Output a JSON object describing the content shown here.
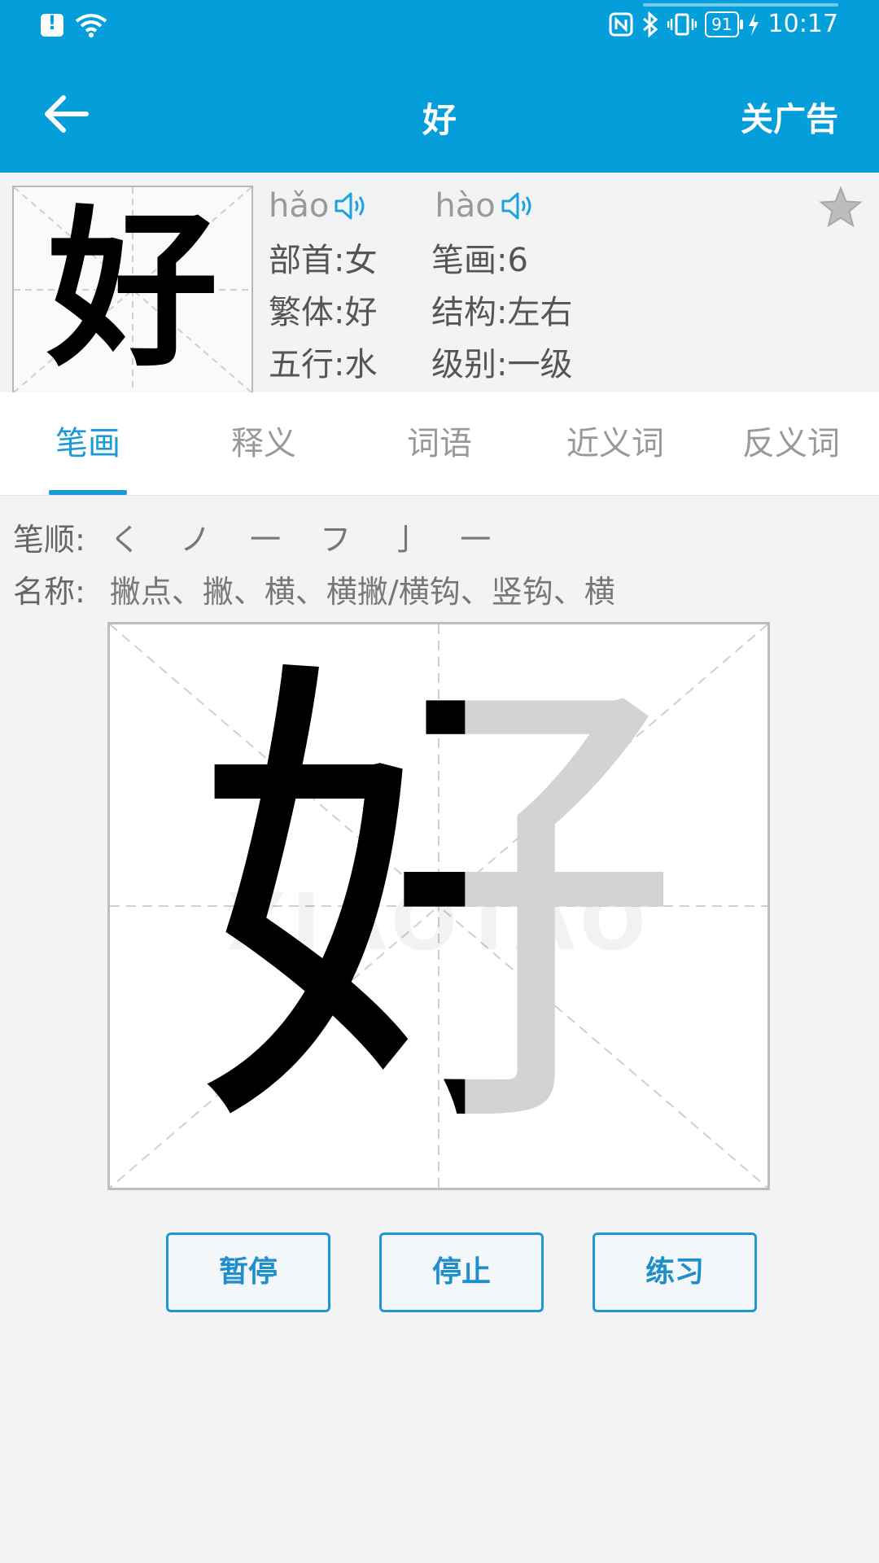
{
  "status_bar": {
    "time": "10:17",
    "battery": "91"
  },
  "header": {
    "title": "好",
    "close_ad": "关广告"
  },
  "character": {
    "glyph": "好",
    "pinyin": [
      "hǎo",
      "hào"
    ],
    "attributes": [
      {
        "label": "部首:",
        "value": "女"
      },
      {
        "label": "笔画:",
        "value": "6"
      },
      {
        "label": "繁体:",
        "value": "好"
      },
      {
        "label": "结构:",
        "value": "左右"
      },
      {
        "label": "五行:",
        "value": "水"
      },
      {
        "label": "级别:",
        "value": "一级"
      }
    ]
  },
  "tabs": [
    "笔画",
    "释义",
    "词语",
    "近义词",
    "反义词"
  ],
  "active_tab": "笔画",
  "stroke_info": {
    "order_label": "笔顺:",
    "order_value": "く ノ 一 フ 亅 一",
    "names_label": "名称:",
    "names_value": "撇点、撇、横、横撇/横钩、竖钩、横"
  },
  "practice": {
    "glyph": "好",
    "watermark": "XIAOTAO",
    "animated_portion": "女"
  },
  "buttons": {
    "pause": "暂停",
    "stop": "停止",
    "practice": "练习"
  },
  "colors": {
    "primary": "#049fdb",
    "accent": "#1a9bd7",
    "ghost": "#d4d2d4"
  },
  "icons": {
    "back": "arrow-left-icon",
    "speaker": "speaker-icon",
    "favorite": "star-icon"
  }
}
